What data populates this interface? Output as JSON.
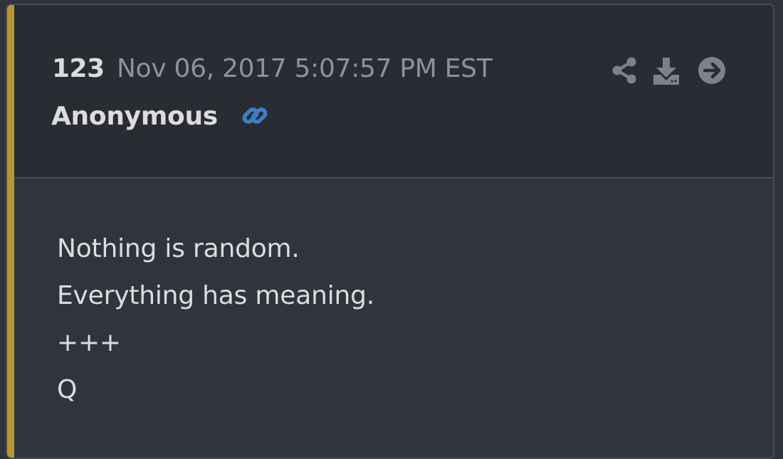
{
  "colors": {
    "accent": "#b8962e",
    "link": "#3a7fc4",
    "icon": "#7d828a"
  },
  "post": {
    "number": "123",
    "timestamp": "Nov 06, 2017 5:07:57 PM EST",
    "author": "Anonymous",
    "lines": [
      "Nothing is random.",
      "Everything has meaning.",
      "+++",
      "Q"
    ]
  },
  "icons": {
    "link": "link-icon",
    "share": "share-icon",
    "download": "download-icon",
    "go": "arrow-right-circle-icon"
  }
}
